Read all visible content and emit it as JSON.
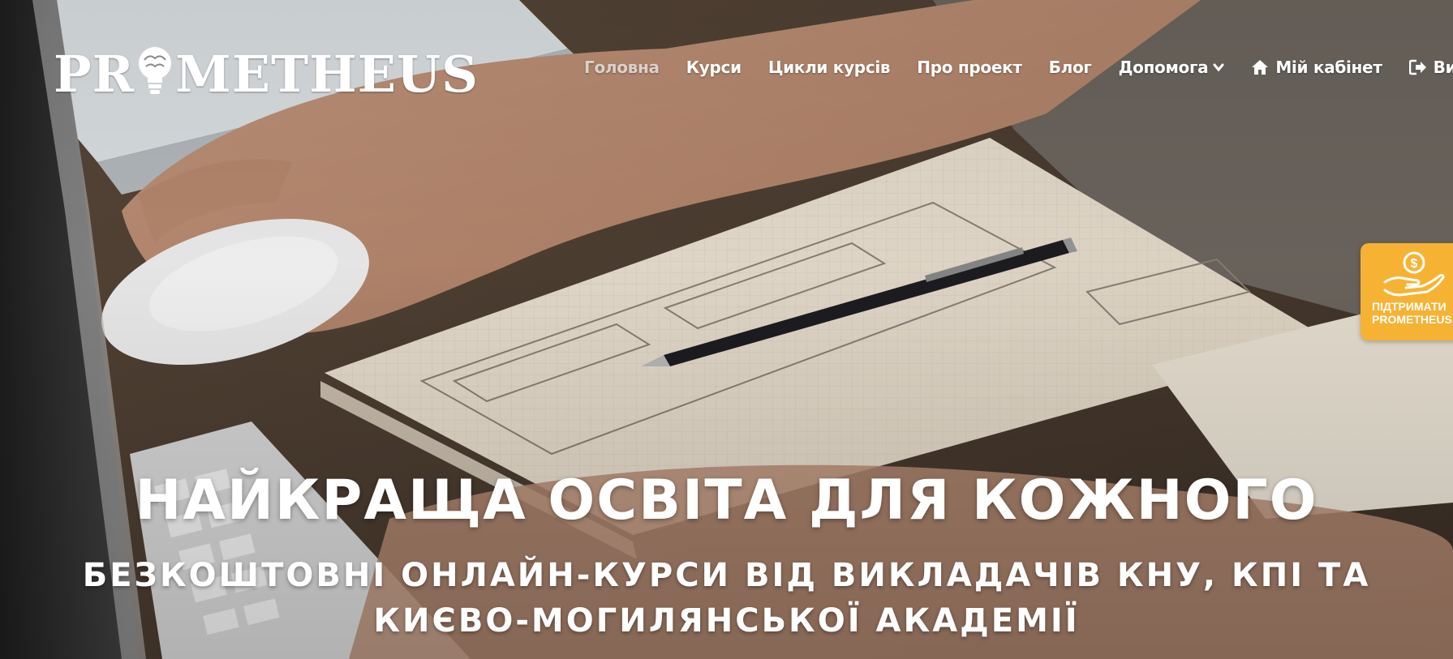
{
  "header": {
    "logo_text_left": "PR",
    "logo_text_right": "METHEUS",
    "nav": [
      {
        "label": "Головна",
        "active": true
      },
      {
        "label": "Курси"
      },
      {
        "label": "Цикли курсів"
      },
      {
        "label": "Про проект"
      },
      {
        "label": "Блог"
      },
      {
        "label": "Допомога",
        "icon": "chevron-down-icon"
      },
      {
        "label": "Мій кабінет",
        "icon": "home-icon"
      },
      {
        "label": "Вийти",
        "icon": "sign-out-icon"
      }
    ]
  },
  "support": {
    "label": "ПІДТРИМАТИ\nPROMETHEUS",
    "icon": "hand-coin-icon"
  },
  "hero": {
    "title": "НАЙКРАЩА ОСВІТА ДЛЯ КОЖНОГО",
    "subtitle": "БЕЗКОШТОВНІ ОНЛАЙН-КУРСИ ВІД ВИКЛАДАЧІВ КНУ, КПІ ТА КИЄВО-МОГИЛЯНСЬКОЇ АКАДЕМІЇ"
  },
  "colors": {
    "support_bg": "#f6b233",
    "nav_text": "#ffffff",
    "nav_active": "#d8d2cb"
  }
}
